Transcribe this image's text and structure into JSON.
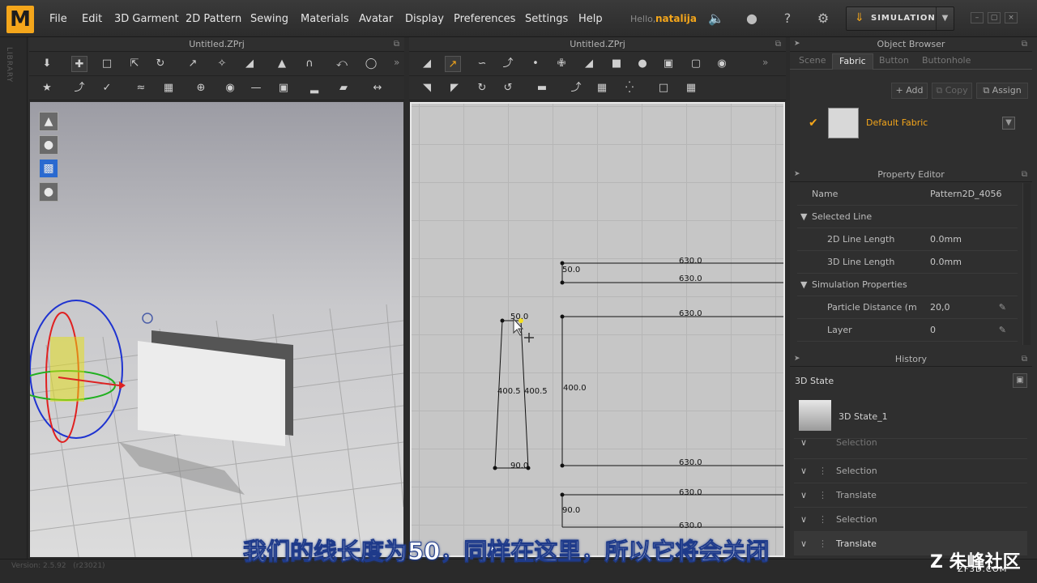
{
  "app": {
    "logo": "M",
    "version": "Version: 2.5.92",
    "build": "(r23021)"
  },
  "menu": [
    "File",
    "Edit",
    "3D Garment",
    "2D Pattern",
    "Sewing",
    "Materials",
    "Avatar",
    "Display",
    "Preferences",
    "Settings",
    "Help"
  ],
  "user": {
    "hello": "Hello,",
    "name": "natalija"
  },
  "simulation": {
    "label": "SIMULATION"
  },
  "library_label": "LIBRARY",
  "window3d": {
    "title": "Untitled.ZPrj"
  },
  "window2d": {
    "title": "Untitled.ZPrj"
  },
  "pattern_dims": {
    "top_a": "630.0",
    "top_a_left": "50.0",
    "top_b": "630.0",
    "mid_top": "630.0",
    "mid_left": "400.0",
    "mid_bottom": "630.0",
    "low_top": "630.0",
    "low_left": "90.0",
    "low_bottom": "630.0",
    "small_top": "50.0",
    "small_left": "400.5",
    "small_right": "400.5",
    "small_bottom": "90.0"
  },
  "object_browser": {
    "title": "Object Browser",
    "tabs": [
      "Scene",
      "Fabric",
      "Button",
      "Buttonhole"
    ],
    "add": "Add",
    "copy": "Copy",
    "assign": "Assign",
    "fabric_name": "Default Fabric"
  },
  "property_editor": {
    "title": "Property Editor",
    "name_key": "Name",
    "name_val": "Pattern2D_4056",
    "selected_line": "Selected Line",
    "len2d_key": "2D Line Length",
    "len2d_val": "0.0mm",
    "len3d_key": "3D Line Length",
    "len3d_val": "0.0mm",
    "sim_props": "Simulation Properties",
    "particle_key": "Particle Distance (m",
    "particle_val": "20,0",
    "layer_key": "Layer",
    "layer_val": "0"
  },
  "history": {
    "title": "History",
    "state_title": "3D State",
    "state_item": "3D State_1",
    "partial": "Selection",
    "rows": [
      "Selection",
      "Translate",
      "Selection",
      "Translate"
    ]
  },
  "subtitle": "我们的线长度为50，同样在这里，所以它将会关闭",
  "watermark": {
    "main": "朱峰社区",
    "sub": "ZF3D.COM"
  }
}
